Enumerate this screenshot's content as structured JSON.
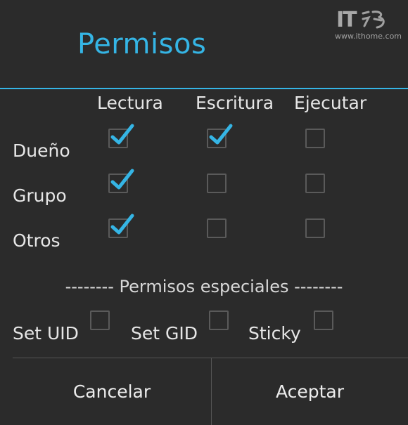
{
  "dialog": {
    "title": "Permisos",
    "accent_color": "#35b5e5",
    "background_color": "#2b2b2b"
  },
  "watermark": {
    "logo_text": "IT",
    "url": "www.ithome.com"
  },
  "columns": [
    "Lectura",
    "Escritura",
    "Ejecutar"
  ],
  "rows": [
    {
      "label": "Dueño",
      "read": true,
      "write": true,
      "execute": false
    },
    {
      "label": "Grupo",
      "read": true,
      "write": false,
      "execute": false
    },
    {
      "label": "Otros",
      "read": true,
      "write": false,
      "execute": false
    }
  ],
  "special": {
    "section_title": "-------- Permisos especiales --------",
    "items": [
      {
        "label": "Set UID",
        "checked": false
      },
      {
        "label": "Set GID",
        "checked": false
      },
      {
        "label": "Sticky",
        "checked": false
      }
    ]
  },
  "buttons": {
    "cancel": "Cancelar",
    "accept": "Aceptar"
  }
}
